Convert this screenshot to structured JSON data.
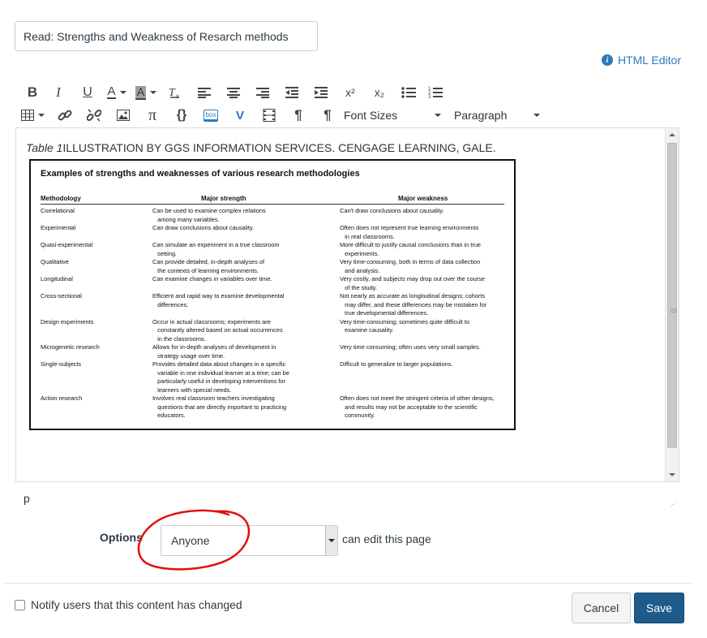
{
  "page": {
    "title_value": "Read: Strengths and Weakness of Resarch methods",
    "html_editor_label": "HTML Editor",
    "info_glyph": "i"
  },
  "toolbar": {
    "row1": [
      {
        "name": "bold-icon",
        "glyph": "B"
      },
      {
        "name": "italic-icon",
        "glyph": "I"
      },
      {
        "name": "underline-icon",
        "glyph": "U"
      },
      {
        "name": "text-color-icon",
        "glyph": "A"
      },
      {
        "name": "background-color-icon",
        "glyph": "A"
      },
      {
        "name": "clear-formatting-icon",
        "glyph": "Tx"
      },
      {
        "name": "align-left-icon"
      },
      {
        "name": "align-center-icon"
      },
      {
        "name": "align-right-icon"
      },
      {
        "name": "outdent-icon"
      },
      {
        "name": "indent-icon"
      },
      {
        "name": "superscript-icon",
        "glyph": "x²"
      },
      {
        "name": "subscript-icon",
        "glyph": "x₂"
      },
      {
        "name": "bullet-list-icon"
      },
      {
        "name": "numbered-list-icon"
      }
    ],
    "row2": [
      {
        "name": "table-icon"
      },
      {
        "name": "link-icon"
      },
      {
        "name": "unlink-icon"
      },
      {
        "name": "image-icon"
      },
      {
        "name": "math-icon",
        "glyph": "π"
      },
      {
        "name": "embed-icon",
        "glyph": "{}"
      },
      {
        "name": "box-icon",
        "glyph": "box"
      },
      {
        "name": "media-v-icon",
        "glyph": "V"
      },
      {
        "name": "media-icon"
      },
      {
        "name": "ltr-icon",
        "glyph": "¶"
      },
      {
        "name": "rtl-icon",
        "glyph": "¶"
      }
    ],
    "font_sizes_label": "Font Sizes",
    "paragraph_label": "Paragraph"
  },
  "editor": {
    "caption_italic": "Table 1",
    "caption_text": "ILLUSTRATION BY GGS INFORMATION SERVICES. CENGAGE LEARNING, GALE.",
    "table_image": {
      "title": "Examples of strengths and weaknesses of various research methodologies",
      "headers": [
        "Methodology",
        "Major strength",
        "Major weakness"
      ],
      "rows": [
        {
          "method": "Correlational",
          "strength": [
            "Can be used to examine complex relations",
            "   among many variables."
          ],
          "weakness": [
            "Can't draw conclusions about causality."
          ]
        },
        {
          "method": "Experimental",
          "strength": [
            "Can draw conclusions about causality."
          ],
          "weakness": [
            "Often does not represent true learning environments",
            "   in real classrooms."
          ]
        },
        {
          "method": "Quasi-experimental",
          "strength": [
            "Can simulate an experiment in a true classroom",
            "   setting."
          ],
          "weakness": [
            "More difficult to justify causal conclusions than in true",
            "   experiments."
          ]
        },
        {
          "method": "Qualitative",
          "strength": [
            "Can provide detailed, in-depth analyses of",
            "   the contexts of learning environments."
          ],
          "weakness": [
            "Very time-consuming, both in terms of data collection",
            "   and analysis."
          ]
        },
        {
          "method": "Longitudinal",
          "strength": [
            "Can examine changes in variables over time."
          ],
          "weakness": [
            "Very costly, and subjects may drop out over the course",
            "   of the study."
          ]
        },
        {
          "method": "Cross-sectional",
          "strength": [
            "Efficient and rapid way to examine developmental",
            "   differences."
          ],
          "weakness": [
            "Not nearly as accurate as longitudinal designs; cohorts",
            "   may differ, and these differences may be mistaken for",
            "   true developmental differences."
          ]
        },
        {
          "method": "Design experiments",
          "strength": [
            "Occur in actual classrooms; experiments are",
            "   constantly altered based on actual occurrences",
            "   in the classrooms."
          ],
          "weakness": [
            "Very time-consuming; sometimes quite difficult to",
            "   examine causality."
          ]
        },
        {
          "method": "Microgenetic research",
          "strength": [
            "Allows for in-depth analyses of development in",
            "   strategy usage over time."
          ],
          "weakness": [
            "Very time consuming; often uses very small samples."
          ]
        },
        {
          "method": "Single-subjects",
          "strength": [
            "Provides detailed data about changes in a specific",
            "   variable in one individual learner at a time; can be",
            "   particularly useful in developing interventions for",
            "   learners with special needs."
          ],
          "weakness": [
            "Difficult to generalize to larger populations."
          ]
        },
        {
          "method": "Action research",
          "strength": [
            "Involves real classroom teachers investigating",
            "   questions that are directly important to practicing",
            "   educators."
          ],
          "weakness": [
            "Often does not meet the stringent criteria of other designs,",
            "   and results may not be acceptable to the scientific",
            "   community."
          ]
        }
      ]
    },
    "status_path": "p"
  },
  "options": {
    "label": "Options",
    "selected": "Anyone",
    "suffix": "can edit this page"
  },
  "footer": {
    "notify_label": "Notify users that this content has changed",
    "notify_checked": false,
    "cancel_label": "Cancel",
    "save_label": "Save"
  },
  "colors": {
    "link": "#2a7abc",
    "save_bg": "#1f5b8a",
    "annotation_red": "#e01010"
  }
}
